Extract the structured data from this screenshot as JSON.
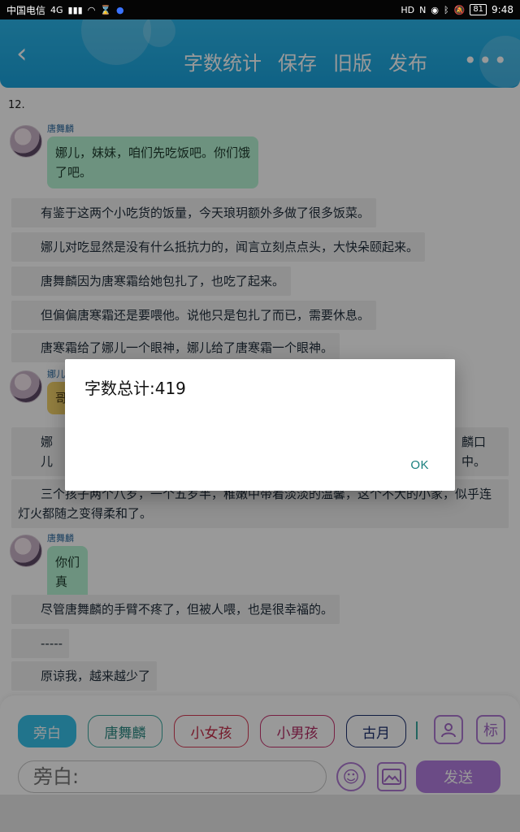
{
  "status_bar": {
    "carrier": "中国电信",
    "network": "4G",
    "battery": "81",
    "time": "9:48"
  },
  "header": {
    "actions": [
      "字数统计",
      "保存",
      "旧版",
      "发布"
    ],
    "more": "•••"
  },
  "content": {
    "chapter": "12.",
    "messages": [
      {
        "speaker": "唐舞麟",
        "text": "娜儿，妹妹，咱们先吃饭吧。你们饿了吧。"
      },
      {
        "speaker": "娜儿",
        "text": "哥"
      },
      {
        "speaker": "唐舞麟",
        "text": "你们真好。"
      }
    ],
    "paragraphs": [
      "有鉴于这两个小吃货的饭量，今天琅玥额外多做了很多饭菜。",
      "娜儿对吃显然是没有什么抵抗力的，闻言立刻点点头，大快朵颐起来。",
      "唐舞麟因为唐寒霜给她包扎了，也吃了起来。",
      "但偏偏唐寒霜还是要喂他。说他只是包扎了而已，需要休息。",
      "唐寒霜给了娜儿一个眼神，娜儿给了唐寒霜一个眼神。",
      "娜儿",
      "麟口中。",
      "三个孩子两个八岁，一个五岁半，稚嫩中带着淡淡的温馨，这个不大的小家，似乎连灯火都随之变得柔和了。",
      "尽管唐舞麟的手臂不疼了，但被人喂，也是很幸福的。",
      "-----",
      "原谅我，越来越少了"
    ]
  },
  "bottom": {
    "roles": [
      "旁白",
      "唐舞麟",
      "小女孩",
      "小男孩",
      "古月"
    ],
    "tag_button": "标",
    "input_placeholder": "旁白:",
    "send_label": "发送"
  },
  "dialog": {
    "title": "字数总计:419",
    "ok_label": "OK"
  },
  "colors": {
    "header": "#1aa3dd",
    "accent_purple": "#b27de0",
    "dialog_ok": "#19807e"
  }
}
